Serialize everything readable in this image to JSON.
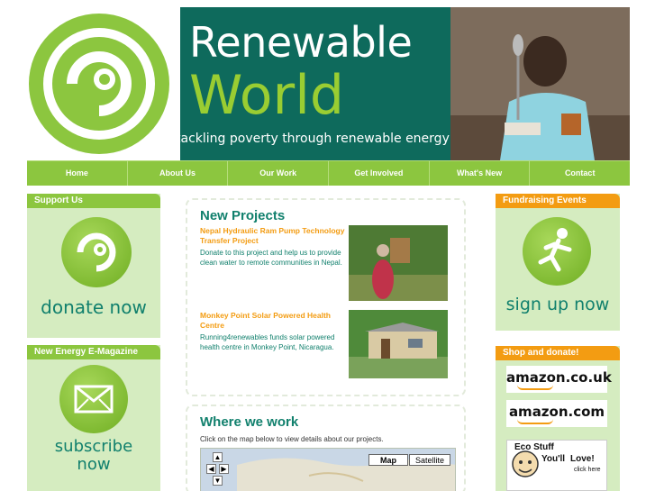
{
  "brand": {
    "line1": "Renewable",
    "line2": "World",
    "tagline": "tackling poverty through renewable energy"
  },
  "nav": [
    "Home",
    "About Us",
    "Our Work",
    "Get Involved",
    "What's New",
    "Contact"
  ],
  "left": {
    "support_heading": "Support Us",
    "donate_label": "donate now",
    "magazine_heading": "New Energy E-Magazine",
    "subscribe_line1": "subscribe",
    "subscribe_line2": "now"
  },
  "projects": {
    "heading": "New Projects",
    "items": [
      {
        "title": "Nepal Hydraulic Ram Pump Technology Transfer Project",
        "desc": "Donate to this project and help us to provide clean water to remote communities in Nepal."
      },
      {
        "title": "Monkey Point Solar Powered Health Centre",
        "desc": "Running4renewables funds solar powered health centre in Monkey Point, Nicaragua."
      }
    ]
  },
  "where": {
    "heading": "Where we work",
    "intro": "Click on the map below to view details about our projects.",
    "map_btn": "Map",
    "satellite_btn": "Satellite"
  },
  "right": {
    "events_heading": "Fundraising Events",
    "signup_label": "sign up now",
    "shop_heading": "Shop and donate!",
    "shops": [
      "amazon.co.uk",
      "amazon.com"
    ],
    "eco_line1": "Eco Stuff",
    "eco_line2": "You'll",
    "eco_line3": "Love!",
    "eco_click": "click here"
  },
  "colors": {
    "green": "#8cc63f",
    "teal": "#11806d",
    "orange": "#f39c12",
    "light_green": "#d5ecc0"
  }
}
